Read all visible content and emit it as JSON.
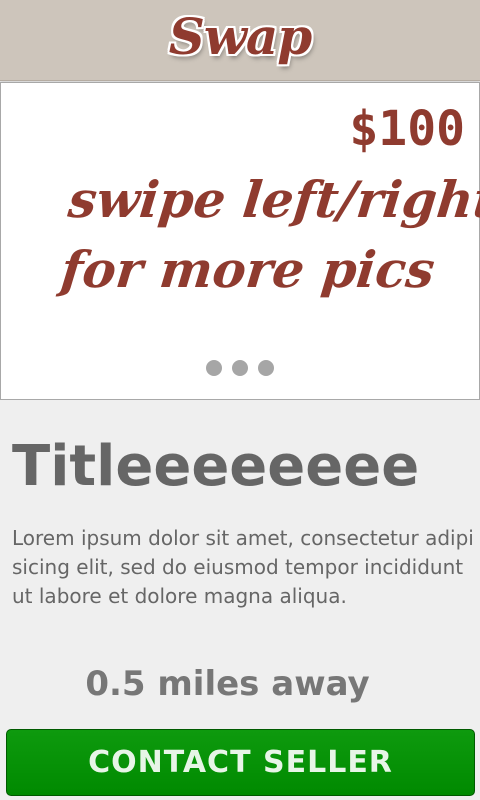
{
  "header": {
    "logo_text": "Swap"
  },
  "gallery": {
    "price": "$100",
    "hint_line1": "swipe left/right",
    "hint_line2": "for more pics",
    "page_count": 3
  },
  "listing": {
    "title": "Titleeeeeeee",
    "description": "Lorem ipsum dolor sit amet, consectetur adipisicing elit, sed do eiusmod tempor incididunt ut labore et dolore magna aliqua.",
    "distance": "0.5 miles away"
  },
  "actions": {
    "contact_label": "CONTACT SELLER"
  },
  "colors": {
    "accent": "#8f3b2f",
    "header_bg": "#cdc5bb",
    "contact_button": "#008a00"
  }
}
